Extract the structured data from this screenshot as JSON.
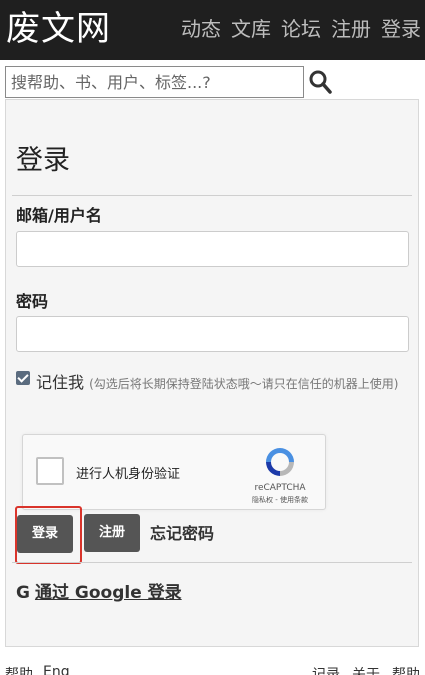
{
  "header": {
    "logo": "废文网",
    "nav": [
      "动态",
      "文库",
      "论坛",
      "注册",
      "登录"
    ]
  },
  "search": {
    "placeholder": "搜帮助、书、用户、标签...?",
    "button_icon": "search-icon"
  },
  "login": {
    "title": "登录",
    "email_label": "邮箱/用户名",
    "password_label": "密码",
    "remember_label": "记住我",
    "remember_hint": "(勾选后将长期保持登陆状态哦～请只在信任的机器上使用)",
    "remember_checked": true,
    "captcha": {
      "label": "进行人机身份验证",
      "brand": "reCAPTCHA",
      "links": "隐私权 - 使用条款",
      "icon": "recaptcha-icon"
    },
    "login_button": "登录",
    "register_button": "注册",
    "forgot_link": "忘记密码",
    "google": {
      "icon": "G",
      "link": "通过 Google 登录"
    },
    "colors": {
      "highlight": "#d9342b",
      "button": "#555555",
      "header": "#1f1f1f"
    }
  },
  "footer": {
    "left": [
      "帮助",
      "Eng"
    ],
    "right": [
      "记录",
      "关于",
      "帮助"
    ]
  }
}
